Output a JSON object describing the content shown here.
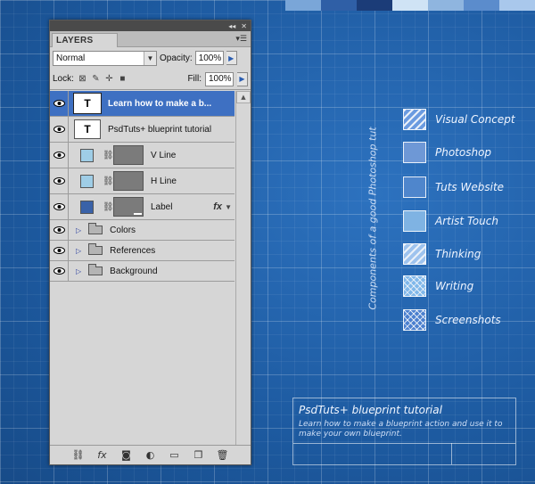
{
  "top_swatch_colors": [
    "#7aa6d8",
    "#2f5fa6",
    "#1b3c78",
    "#cfe3f5",
    "#8fb5df",
    "#5b8ccc",
    "#a9c8ec"
  ],
  "panel": {
    "tab_label": "LAYERS",
    "blend_mode": "Normal",
    "opacity_label": "Opacity:",
    "opacity_value": "100%",
    "lock_label": "Lock:",
    "fill_label": "Fill:",
    "fill_value": "100%",
    "layers": [
      {
        "name": "Learn how to make a b...",
        "kind": "text",
        "selected": true
      },
      {
        "name": "PsdTuts+ blueprint tutorial",
        "kind": "text",
        "selected": false
      },
      {
        "name": "V Line",
        "kind": "shape",
        "color": "#9fcde6"
      },
      {
        "name": "H Line",
        "kind": "shape",
        "color": "#9fcde6"
      },
      {
        "name": "Label",
        "kind": "shape",
        "color": "#3a62a8",
        "has_fx": true,
        "fx_label": "fx"
      },
      {
        "name": "Colors",
        "kind": "group"
      },
      {
        "name": "References",
        "kind": "group"
      },
      {
        "name": "Background",
        "kind": "group"
      }
    ],
    "bottom_icons": [
      "link-icon",
      "fx-icon",
      "mask-icon",
      "adjustment-icon",
      "folder-icon",
      "new-layer-icon",
      "trash-icon"
    ]
  },
  "vertical_label": "Components of a good Photoshop tut",
  "legend": [
    {
      "label": "Visual Concept",
      "style": "hatch",
      "color": "#6b9be0"
    },
    {
      "label": "Photoshop",
      "style": "solid",
      "color": "#6e98d6"
    },
    {
      "label": "Tuts Website",
      "style": "solid",
      "color": "#4f86cc"
    },
    {
      "label": "Artist Touch",
      "style": "solid",
      "color": "#7fb3e3"
    },
    {
      "label": "Thinking",
      "style": "hatch",
      "color": "#9ec3ee"
    },
    {
      "label": "Writing",
      "style": "cross",
      "color": "#7fb7ea"
    },
    {
      "label": "Screenshots",
      "style": "cross",
      "color": "#4a7fcf"
    }
  ],
  "infobox": {
    "title": "PsdTuts+ blueprint tutorial",
    "description": "Learn how to make a blueprint action and use it to make your own blueprint."
  }
}
